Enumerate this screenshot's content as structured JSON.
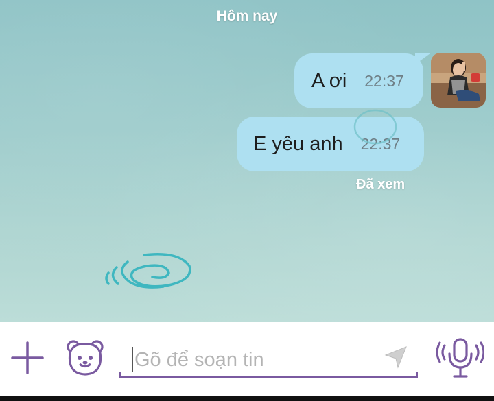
{
  "chat": {
    "date_label": "Hôm nay",
    "messages": [
      {
        "text": "A ơi",
        "time": "22:37",
        "direction": "outgoing"
      },
      {
        "text": "E yêu anh",
        "time": "22:37",
        "direction": "outgoing"
      }
    ],
    "status": "Đã xem"
  },
  "composer": {
    "placeholder": "Gõ để soạn tin",
    "value": ""
  },
  "icons": {
    "add": "plus-icon",
    "sticker": "bear-sticker-icon",
    "send": "send-arrow-icon",
    "voice": "microphone-icon"
  },
  "colors": {
    "bubble": "#aee0f1",
    "accent": "#7a5aa0",
    "background_top": "#8fc3c6",
    "background_bottom": "#bcddd8"
  }
}
